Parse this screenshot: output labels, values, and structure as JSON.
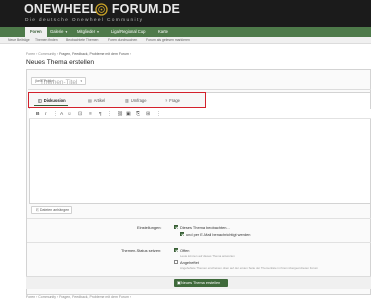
{
  "site": {
    "logo_part1": "ONEWHEEL",
    "logo_part2": "FORUM.DE",
    "tagline": "Die deutsche Onewheel Community"
  },
  "nav": {
    "items": [
      {
        "label": "Foren"
      },
      {
        "label": "Galerie"
      },
      {
        "label": "Mitglieder"
      },
      {
        "label": "Liga/Regional Cup"
      },
      {
        "label": "Karte"
      }
    ]
  },
  "subnav": {
    "items": [
      {
        "label": "Neue Beiträge"
      },
      {
        "label": "Themen finden"
      },
      {
        "label": "Beobachtete Themen"
      },
      {
        "label": "Foren durchsuchen"
      },
      {
        "label": "Forum als gelesen markieren"
      }
    ]
  },
  "breadcrumb": {
    "items": [
      "Foren",
      "Community",
      "Fragen, Feedback, Probleme mit dem Forum"
    ]
  },
  "page": {
    "title": "Neues Thema erstellen"
  },
  "form": {
    "prefix": "(kein Präfix)",
    "title_placeholder": "Themen-Titel",
    "tabs": [
      {
        "label": "Diskussion",
        "icon": "comments-icon",
        "active": true
      },
      {
        "label": "Artikel",
        "icon": "article-icon",
        "active": false
      },
      {
        "label": "Umfrage",
        "icon": "poll-icon",
        "active": false
      },
      {
        "label": "Frage",
        "icon": "question-icon",
        "active": false
      }
    ],
    "toolbar": [
      "B",
      "I",
      "⋮",
      "A",
      "☺",
      "⊡",
      "≡",
      "¶",
      "⋮",
      "⛓",
      "▣",
      "⎘",
      "⊞",
      "⋮"
    ],
    "attach_label": "Dateien anhängen",
    "options": {
      "label": "Einstellungen:",
      "watch": "Dieses Thema beobachten...",
      "email": "und per E-Mail benachrichtigt werden"
    },
    "status": {
      "label": "Themen-Status setzen:",
      "open": "Offen",
      "open_hint": "Leute können auf dieses Thema antworten",
      "sticky": "Angeheftet",
      "sticky_hint": "Angeheftete Themen erscheinen oben auf der ersten Seite der Themenliste in ihrem übergeordneten Forum"
    },
    "submit_label": "Neues Thema erstellen"
  },
  "colors": {
    "header_bg": "#1b1b1b",
    "nav_green": "#4e7a4a",
    "highlight_red": "#d3212c",
    "accent_dark_green": "#3f6a3b"
  }
}
